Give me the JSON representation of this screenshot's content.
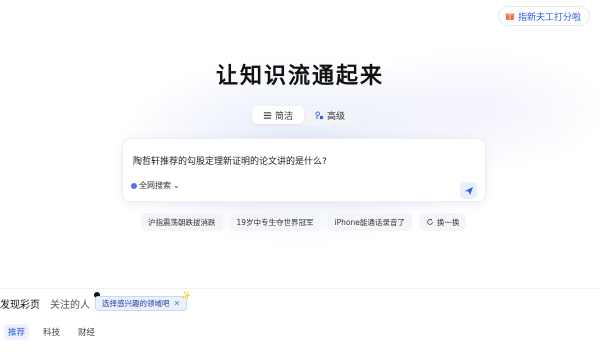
{
  "header": {
    "top_right_button": "指新夫工打分啦"
  },
  "hero": {
    "title": "让知识流通起来"
  },
  "mode_switch": {
    "tabs": [
      {
        "label": "简洁",
        "active": true,
        "icon": "list-icon"
      },
      {
        "label": "高级",
        "active": false,
        "icon": "advanced-icon"
      }
    ]
  },
  "search": {
    "value": "陶哲轩推荐的勾股定理新证明的论文讲的是什么?",
    "scope": "全网搜索",
    "send_icon": "send-icon"
  },
  "suggestions": [
    {
      "label": "沪指震荡朝跌拔消跌"
    },
    {
      "label": "19岁中专生夺世界冠军"
    },
    {
      "label": "iPhone能通话录音了"
    },
    {
      "label": "换一换",
      "icon": "refresh-icon"
    }
  ],
  "feed": {
    "tabs": [
      {
        "label": "发现彩页",
        "active": true
      },
      {
        "label": "关注的人",
        "active": false
      }
    ],
    "tooltip": "选择感兴趣的领域吧",
    "sub_tabs": [
      {
        "label": "推荐",
        "active": true
      },
      {
        "label": "科技",
        "active": false
      },
      {
        "label": "财经",
        "active": false
      }
    ]
  },
  "colors": {
    "accent": "#2b5ce6",
    "tooltip_bg": "#eaf0fe"
  }
}
